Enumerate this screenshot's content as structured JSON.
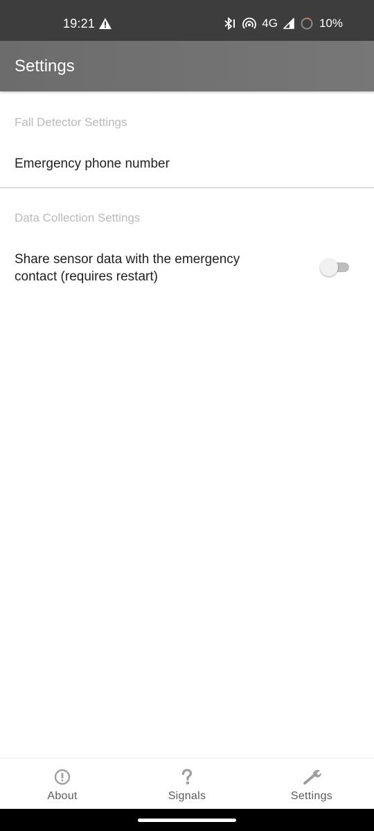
{
  "status_bar": {
    "time": "19:21",
    "network": "4G",
    "battery": "10%"
  },
  "app_bar": {
    "title": "Settings"
  },
  "sections": [
    {
      "title": "Fall Detector Settings",
      "items": [
        {
          "label": "Emergency phone number"
        }
      ]
    },
    {
      "title": "Data Collection Settings",
      "items": [
        {
          "label_line1": "Share sensor data with the emergency",
          "label_line2": "contact (requires restart)",
          "toggle_on": false
        }
      ]
    }
  ],
  "bottom_nav": {
    "items": [
      {
        "label": "About",
        "icon": "info-icon"
      },
      {
        "label": "Signals",
        "icon": "question-icon"
      },
      {
        "label": "Settings",
        "icon": "wrench-icon"
      }
    ]
  },
  "colors": {
    "status_bar": "#3d3d3d",
    "app_bar": "#707070",
    "category_text": "#b9b9b9",
    "body_text": "#1f1f1f",
    "nav_icon": "#9e9e9e"
  }
}
